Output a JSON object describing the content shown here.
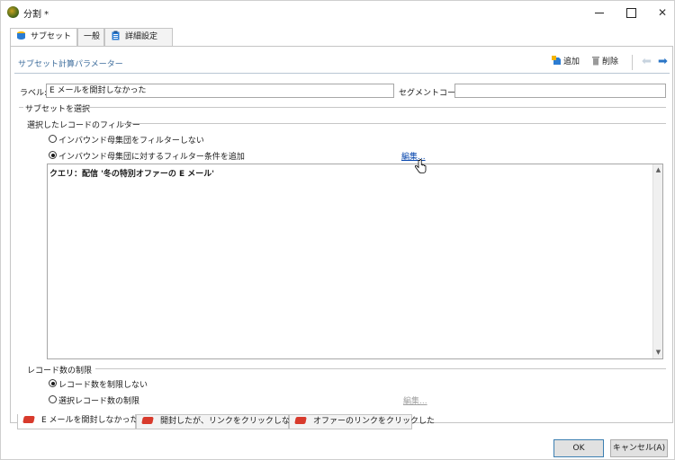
{
  "window": {
    "title": "分割 *",
    "icons": {
      "app": "app-logo-icon",
      "minimize": "minimize-icon",
      "maximize": "maximize-icon",
      "close": "close-icon"
    }
  },
  "tabs": [
    {
      "label": "サブセット",
      "icon": "subset-icon",
      "active": true
    },
    {
      "label": "一般",
      "active": false
    },
    {
      "label": "詳細設定",
      "icon": "clipboard-icon",
      "active": false
    }
  ],
  "param_bar": {
    "title": "サブセット計算パラメーター",
    "add_label": "追加",
    "delete_label": "削除"
  },
  "form": {
    "label_caption": "ラベル:",
    "label_value": "E メールを開封しなかった",
    "segment_caption": "セグメントコード:",
    "segment_value": ""
  },
  "select_subset": {
    "title": "サブセットを選択",
    "filter_group": "選択したレコードのフィルター",
    "radio_no_filter": "インバウンド母集団をフィルターしない",
    "radio_add_filter": "インバウンド母集団に対するフィルター条件を追加",
    "edit_link": "編集...",
    "query_text": "クエリ：配信 '冬の特別オファーの E メール'"
  },
  "limit": {
    "group": "レコード数の制限",
    "radio_no_limit": "レコード数を制限しない",
    "radio_limit": "選択レコード数の制限",
    "edit_link": "編集..."
  },
  "bottom_tabs": [
    {
      "label": "E メールを開封しなかった",
      "active": true
    },
    {
      "label": "開封したが、リンクをクリックしなかった",
      "active": false
    },
    {
      "label": "オファーのリンクをクリックした",
      "active": false
    }
  ],
  "buttons": {
    "ok": "OK",
    "cancel": "キャンセル(A)"
  },
  "colors": {
    "accent": "#3e6d9c",
    "link": "#0645ad",
    "tab_icon_red": "#d83a2c"
  }
}
